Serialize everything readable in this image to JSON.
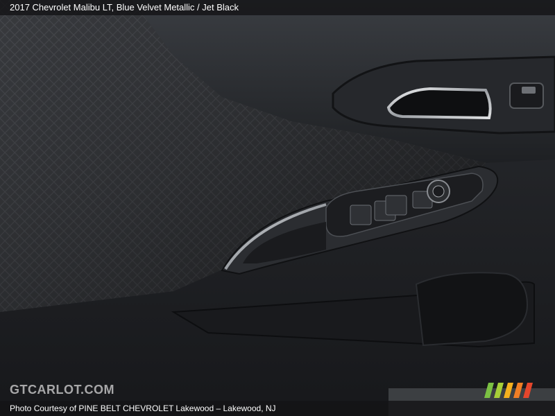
{
  "caption": {
    "vehicle": "2017 Chevrolet Malibu LT,",
    "colors": "Blue Velvet Metallic / Jet Black"
  },
  "footer": {
    "credit": "Photo Courtesy of PINE BELT CHEVROLET Lakewood – Lakewood, NJ"
  },
  "watermark": {
    "text": "GTCARLOT.COM",
    "stripe_colors": [
      "#7bc143",
      "#a6cf38",
      "#f4b01e",
      "#f07e25",
      "#e4462c"
    ]
  },
  "palette": {
    "fabric": "#3a3c3f",
    "trim": "#2a2c2f",
    "chrome": "#cfd2d5"
  }
}
